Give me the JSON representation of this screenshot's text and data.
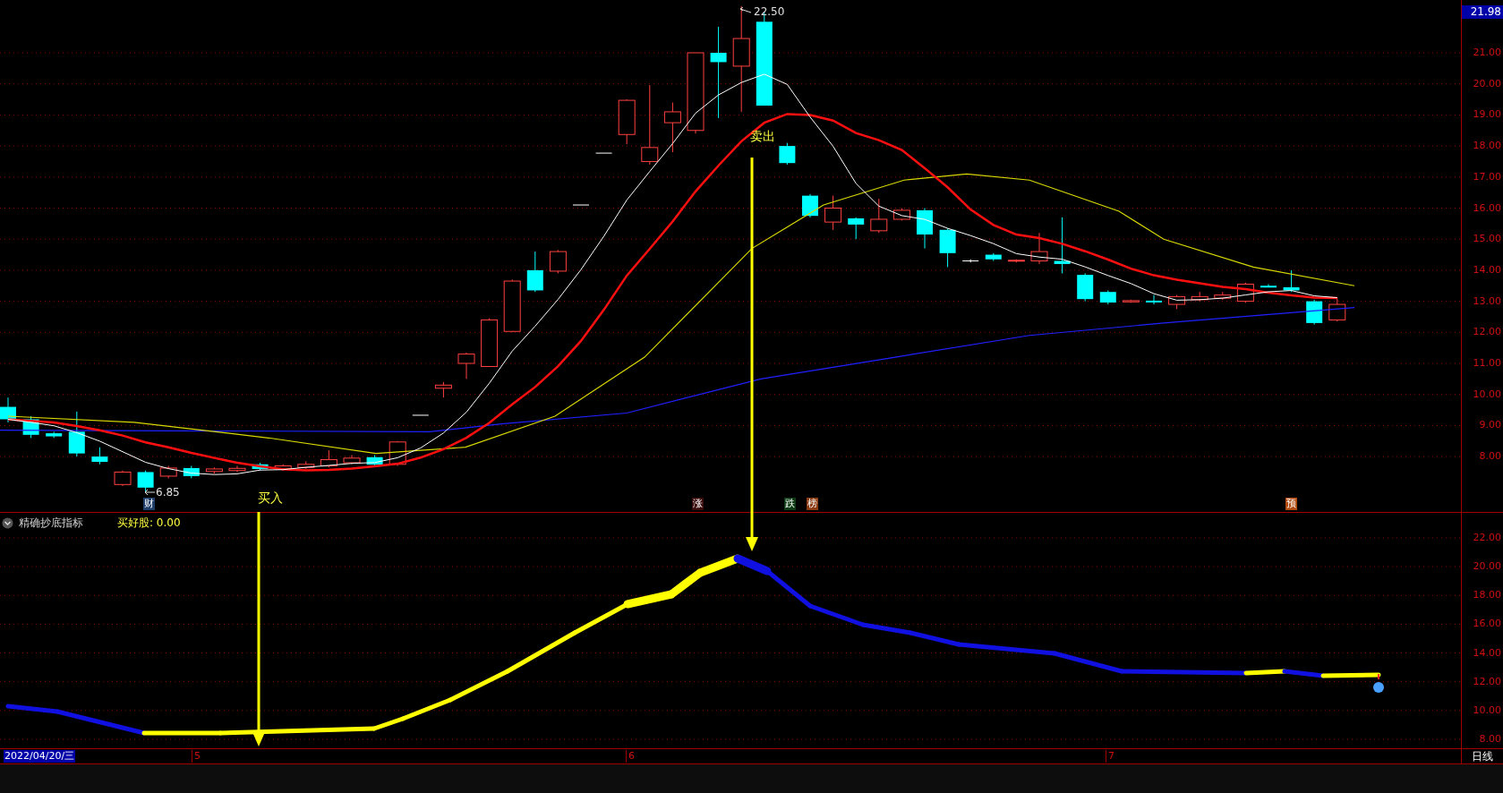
{
  "price_panel": {
    "high_label": "22.50",
    "low_label": "6.85",
    "current_price": "21.98",
    "y_axis": [
      "21.00",
      "20.00",
      "19.00",
      "18.00",
      "17.00",
      "16.00",
      "15.00",
      "14.00",
      "13.00",
      "12.00",
      "11.00",
      "10.00",
      "9.00",
      "8.00"
    ],
    "signals": [
      {
        "text": "财",
        "color": "#1f3f6a"
      },
      {
        "text": "涨",
        "color": "#3a0c0c"
      },
      {
        "text": "跌",
        "color": "#0d3a12"
      },
      {
        "text": "榜",
        "color": "#8a3a10"
      },
      {
        "text": "预",
        "color": "#b04a10"
      }
    ],
    "annotations": [
      {
        "text": "买入"
      },
      {
        "text": "卖出"
      }
    ]
  },
  "indicator_panel": {
    "title": "精确抄底指标",
    "value_text": "买好股: 0.00",
    "y_axis": [
      "22.00",
      "20.00",
      "18.00",
      "16.00",
      "14.00",
      "12.00",
      "10.00",
      "8.00"
    ]
  },
  "time_axis": {
    "date": "2022/04/20/三",
    "months": [
      "5",
      "6",
      "7"
    ],
    "period": "日线"
  }
}
